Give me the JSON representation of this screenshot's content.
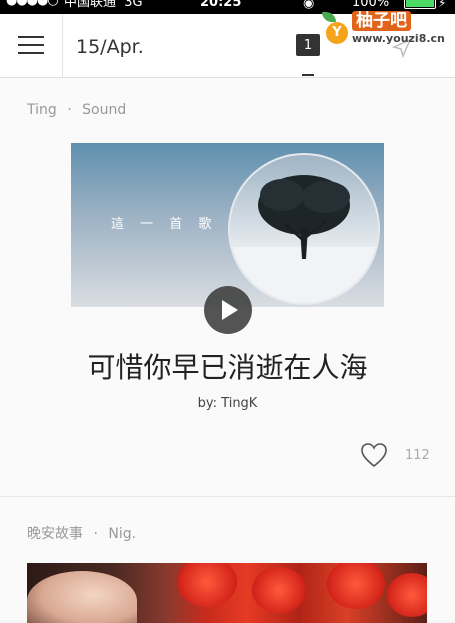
{
  "status_bar": {
    "signal": "●●●●○",
    "carrier": "中国联通",
    "network": "3G",
    "time": "20:25",
    "battery": "100%"
  },
  "watermark": {
    "badge": "Y",
    "title": "柚子吧",
    "site": "www.youzi8.cn"
  },
  "header": {
    "date": "15/Apr.",
    "calendar_day": "1"
  },
  "feed": [
    {
      "category": "Ting",
      "separator": "·",
      "subcategory": "Sound",
      "cover_text": "這 一 首 歌",
      "title": "可惜你早已消逝在人海",
      "author": "by: TingK",
      "likes": "112"
    },
    {
      "category": "晚安故事",
      "separator": "·",
      "subcategory": "Nig."
    }
  ],
  "colors": {
    "status_bar_bg": "#000000",
    "battery_fill": "#4cd964",
    "page_bg": "#fafafa",
    "text_primary": "#222222",
    "text_muted": "#999999"
  }
}
